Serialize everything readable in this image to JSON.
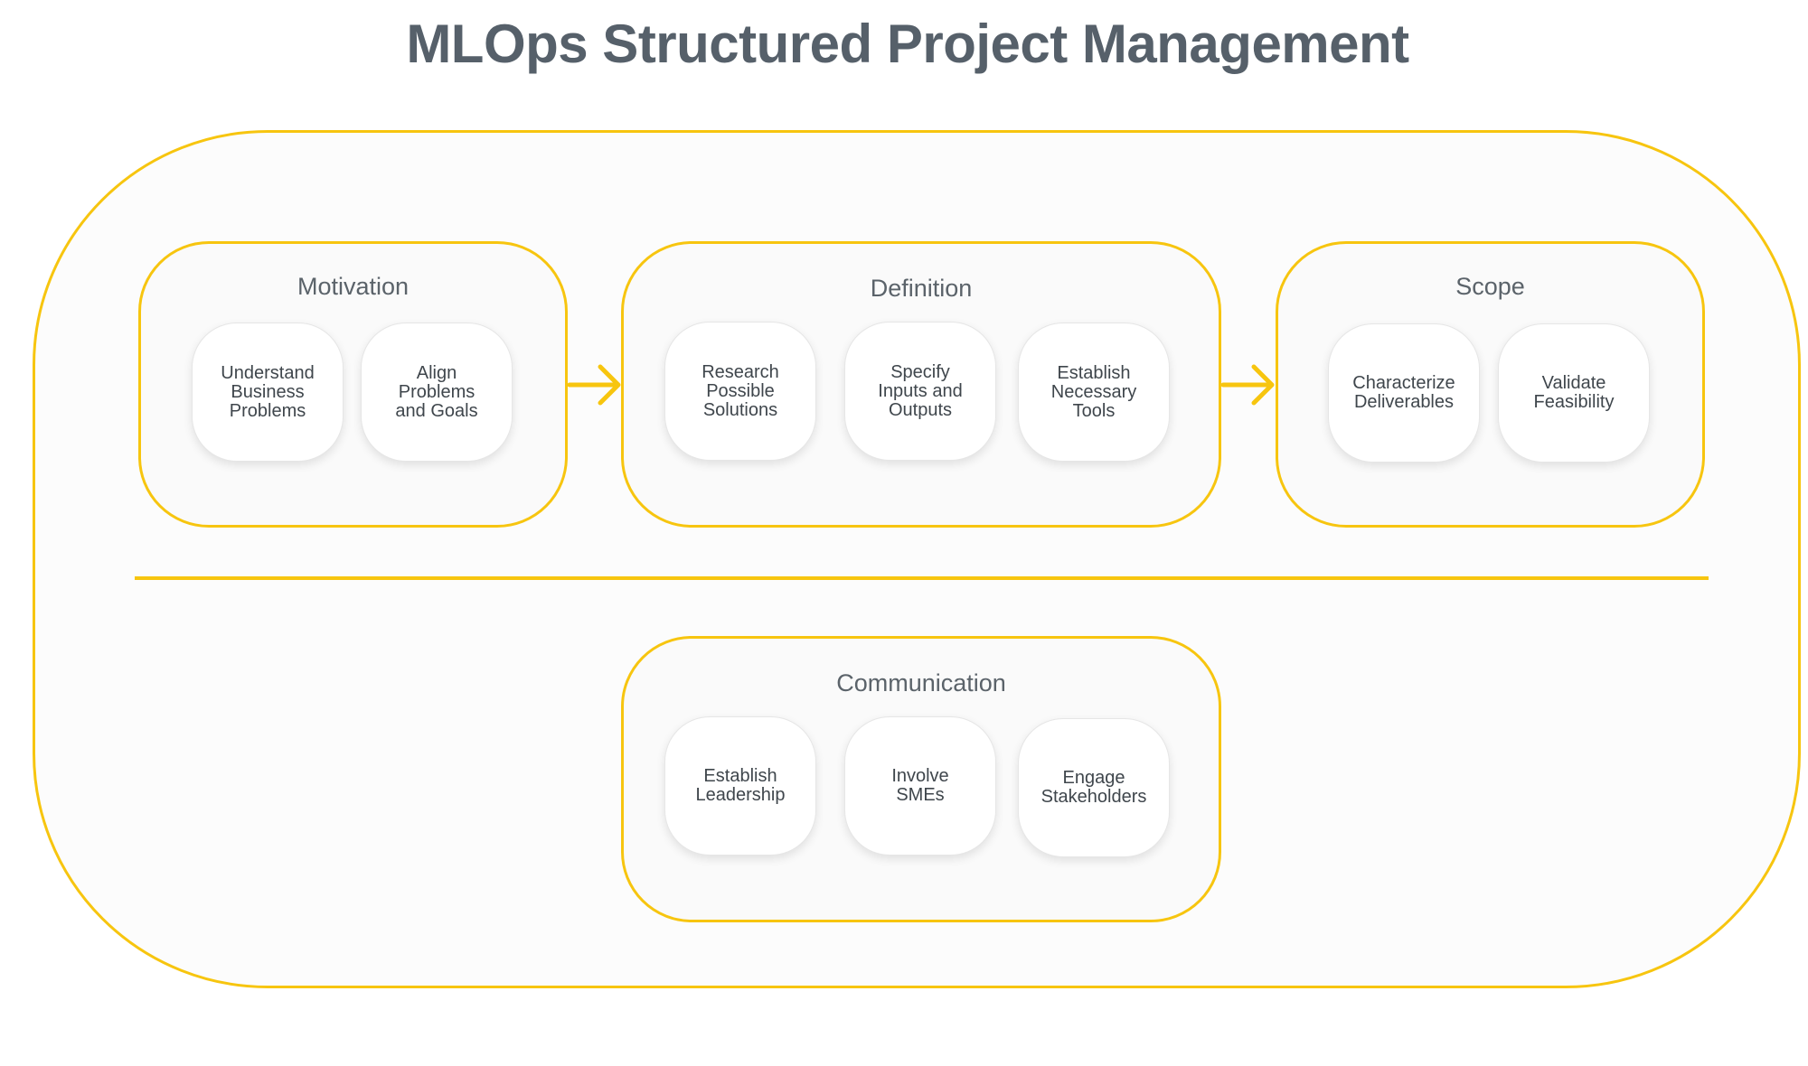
{
  "title": "MLOps Structured Project Management",
  "colors": {
    "accent": "#f7c50f",
    "title_text": "#56606a",
    "card_text": "#3f464c"
  },
  "groups": {
    "motivation": {
      "title": "Motivation",
      "cards": [
        "Understand\nBusiness\nProblems",
        "Align\nProblems\nand Goals"
      ]
    },
    "definition": {
      "title": "Definition",
      "cards": [
        "Research\nPossible\nSolutions",
        "Specify\nInputs and\nOutputs",
        "Establish\nNecessary\nTools"
      ]
    },
    "scope": {
      "title": "Scope",
      "cards": [
        "Characterize\nDeliverables",
        "Validate\nFeasibility"
      ]
    },
    "communication": {
      "title": "Communication",
      "cards": [
        "Establish\nLeadership",
        "Involve\nSMEs",
        "Engage\nStakeholders"
      ]
    }
  },
  "flow": [
    {
      "from": "Motivation",
      "to": "Definition",
      "icon": "arrow-right-icon"
    },
    {
      "from": "Definition",
      "to": "Scope",
      "icon": "arrow-right-icon"
    }
  ]
}
